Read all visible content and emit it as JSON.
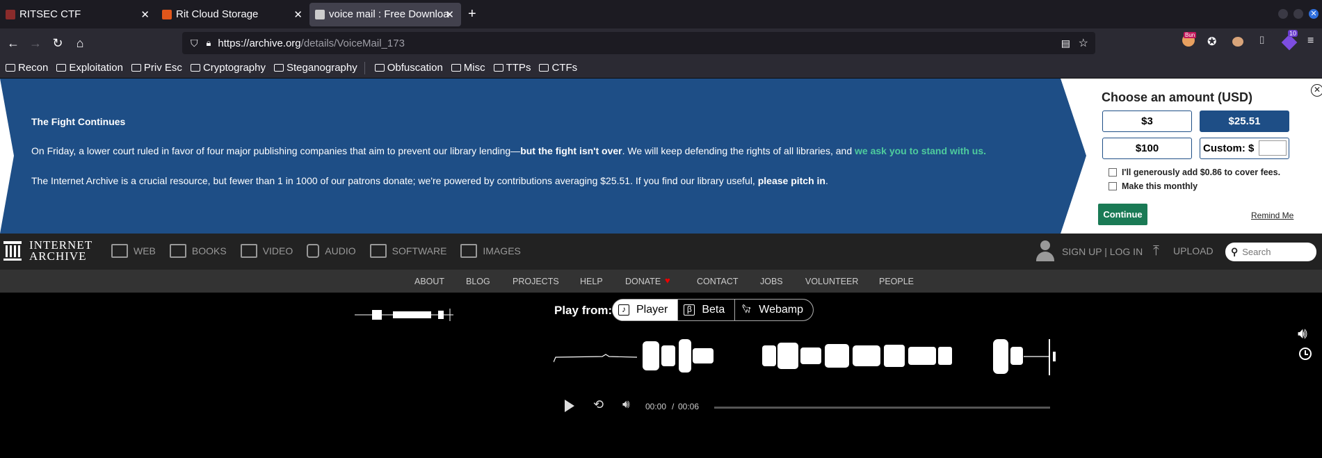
{
  "browser": {
    "tabs": [
      {
        "label": "RITSEC CTF",
        "favicon_color": "#8a2b2b"
      },
      {
        "label": "Rit Cloud Storage",
        "favicon_color": "#e0561b"
      },
      {
        "label": "voice mail : Free Downloa",
        "favicon_color": "#cccccc"
      }
    ],
    "url_host": "https://archive.org",
    "url_path": "/details/VoiceMail_173",
    "extension_badge": "10",
    "ext_label": "Bun",
    "bookmarks": [
      "Recon",
      "Exploitation",
      "Priv Esc",
      "Cryptography",
      "Steganography",
      "Obfuscation",
      "Misc",
      "TTPs",
      "CTFs"
    ]
  },
  "banner": {
    "title": "The Fight Continues",
    "p1_a": "On Friday, a lower court ruled in favor of four major publishing companies that aim to prevent our library lending—",
    "p1_b": "but the fight isn't over",
    "p1_c": ". We will keep defending the rights of all libraries, and ",
    "p1_d": "we ask you to stand with us.",
    "p2_a": "The Internet Archive is a crucial resource, but fewer than 1 in 1000 of our patrons donate; we're powered by contributions averaging $25.51. If you find our library useful, ",
    "p2_b": "please pitch in",
    "p2_c": ".",
    "choose": "Choose an amount (USD)",
    "amounts": [
      "$3",
      "$25.51",
      "$100"
    ],
    "custom": "Custom: $",
    "fee": "I'll generously add $0.86 to cover fees.",
    "monthly": "Make this monthly",
    "continue": "Continue",
    "remind": "Remind Me",
    "blue": "#1e4e86",
    "green_link": "#4ecc9d",
    "continue_color": "#1a7a55"
  },
  "ia": {
    "logo_top": "INTERNET",
    "logo_bottom": "ARCHIVE",
    "nav": [
      "WEB",
      "BOOKS",
      "VIDEO",
      "AUDIO",
      "SOFTWARE",
      "IMAGES"
    ],
    "signup": "SIGN UP | LOG IN",
    "upload": "UPLOAD",
    "search_placeholder": "Search",
    "subnav": [
      "ABOUT",
      "BLOG",
      "PROJECTS",
      "HELP",
      "DONATE",
      "CONTACT",
      "JOBS",
      "VOLUNTEER",
      "PEOPLE"
    ]
  },
  "player": {
    "play_from": "Play from:",
    "options": [
      "Player",
      "Beta",
      "Webamp"
    ],
    "current": "00:00",
    "sep": "/",
    "duration": "00:06",
    "progress": 0
  }
}
